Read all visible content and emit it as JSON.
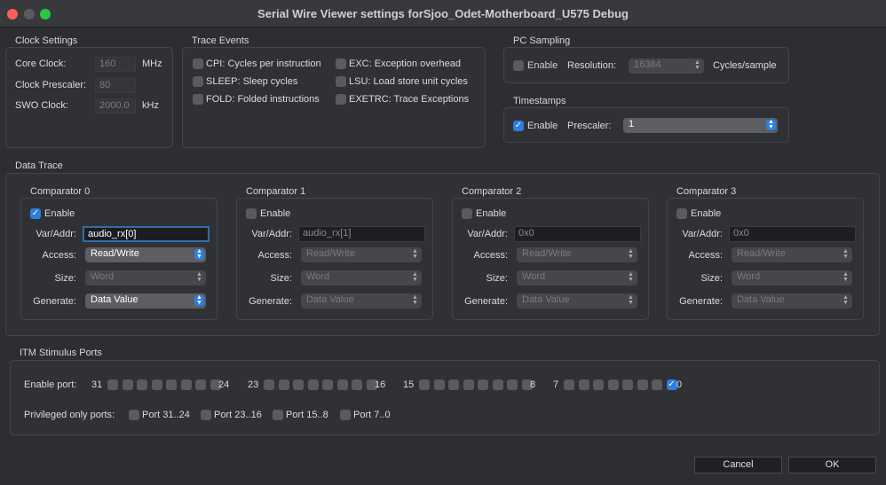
{
  "window": {
    "title": "Serial Wire Viewer settings forSjoo_Odet-Motherboard_U575 Debug"
  },
  "clock": {
    "title": "Clock Settings",
    "core_label": "Core Clock:",
    "core_value": "160",
    "core_unit": "MHz",
    "prescaler_label": "Clock Prescaler:",
    "prescaler_value": "80",
    "swo_label": "SWO Clock:",
    "swo_value": "2000.0",
    "swo_unit": "kHz"
  },
  "trace_events": {
    "title": "Trace Events",
    "items": [
      {
        "label": "CPI: Cycles per instruction",
        "checked": false
      },
      {
        "label": "SLEEP: Sleep cycles",
        "checked": false
      },
      {
        "label": "FOLD: Folded instructions",
        "checked": false
      },
      {
        "label": "EXC: Exception overhead",
        "checked": false
      },
      {
        "label": "LSU: Load store unit cycles",
        "checked": false
      },
      {
        "label": "EXETRC: Trace Exceptions",
        "checked": false
      }
    ]
  },
  "pc_sampling": {
    "title": "PC Sampling",
    "enable_label": "Enable",
    "enabled": false,
    "resolution_label": "Resolution:",
    "resolution_value": "16384",
    "unit": "Cycles/sample"
  },
  "timestamps": {
    "title": "Timestamps",
    "enable_label": "Enable",
    "enabled": true,
    "prescaler_label": "Prescaler:",
    "prescaler_value": "1"
  },
  "data_trace": {
    "title": "Data Trace",
    "labels": {
      "enable": "Enable",
      "var": "Var/Addr:",
      "access": "Access:",
      "size": "Size:",
      "generate": "Generate:"
    },
    "comparators": [
      {
        "title": "Comparator 0",
        "enabled": true,
        "var": "audio_rx[0]",
        "access": "Read/Write",
        "size": "Word",
        "generate": "Data Value"
      },
      {
        "title": "Comparator 1",
        "enabled": false,
        "var": "audio_rx[1]",
        "access": "Read/Write",
        "size": "Word",
        "generate": "Data Value"
      },
      {
        "title": "Comparator 2",
        "enabled": false,
        "var": "0x0",
        "access": "Read/Write",
        "size": "Word",
        "generate": "Data Value"
      },
      {
        "title": "Comparator 3",
        "enabled": false,
        "var": "0x0",
        "access": "Read/Write",
        "size": "Word",
        "generate": "Data Value"
      }
    ]
  },
  "itm": {
    "title": "ITM Stimulus Ports",
    "enable_label": "Enable port:",
    "groups": [
      {
        "hi": "31",
        "lo": "24"
      },
      {
        "hi": "23",
        "lo": "16"
      },
      {
        "hi": "15",
        "lo": "8"
      },
      {
        "hi": "7",
        "lo": "0"
      }
    ],
    "enabled_ports": [
      0
    ],
    "privileged_label": "Privileged only ports:",
    "privileged": [
      {
        "label": "Port 31..24",
        "checked": false
      },
      {
        "label": "Port 23..16",
        "checked": false
      },
      {
        "label": "Port 15..8",
        "checked": false
      },
      {
        "label": "Port 7..0",
        "checked": false
      }
    ]
  },
  "buttons": {
    "cancel": "Cancel",
    "ok": "OK"
  }
}
